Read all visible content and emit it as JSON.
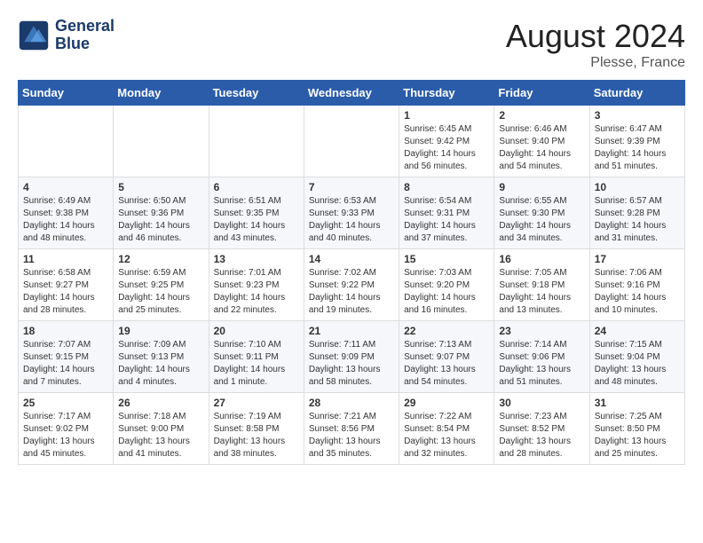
{
  "header": {
    "logo_line1": "General",
    "logo_line2": "Blue",
    "month_year": "August 2024",
    "location": "Plesse, France"
  },
  "weekdays": [
    "Sunday",
    "Monday",
    "Tuesday",
    "Wednesday",
    "Thursday",
    "Friday",
    "Saturday"
  ],
  "weeks": [
    [
      {
        "day": "",
        "info": ""
      },
      {
        "day": "",
        "info": ""
      },
      {
        "day": "",
        "info": ""
      },
      {
        "day": "",
        "info": ""
      },
      {
        "day": "1",
        "info": "Sunrise: 6:45 AM\nSunset: 9:42 PM\nDaylight: 14 hours\nand 56 minutes."
      },
      {
        "day": "2",
        "info": "Sunrise: 6:46 AM\nSunset: 9:40 PM\nDaylight: 14 hours\nand 54 minutes."
      },
      {
        "day": "3",
        "info": "Sunrise: 6:47 AM\nSunset: 9:39 PM\nDaylight: 14 hours\nand 51 minutes."
      }
    ],
    [
      {
        "day": "4",
        "info": "Sunrise: 6:49 AM\nSunset: 9:38 PM\nDaylight: 14 hours\nand 48 minutes."
      },
      {
        "day": "5",
        "info": "Sunrise: 6:50 AM\nSunset: 9:36 PM\nDaylight: 14 hours\nand 46 minutes."
      },
      {
        "day": "6",
        "info": "Sunrise: 6:51 AM\nSunset: 9:35 PM\nDaylight: 14 hours\nand 43 minutes."
      },
      {
        "day": "7",
        "info": "Sunrise: 6:53 AM\nSunset: 9:33 PM\nDaylight: 14 hours\nand 40 minutes."
      },
      {
        "day": "8",
        "info": "Sunrise: 6:54 AM\nSunset: 9:31 PM\nDaylight: 14 hours\nand 37 minutes."
      },
      {
        "day": "9",
        "info": "Sunrise: 6:55 AM\nSunset: 9:30 PM\nDaylight: 14 hours\nand 34 minutes."
      },
      {
        "day": "10",
        "info": "Sunrise: 6:57 AM\nSunset: 9:28 PM\nDaylight: 14 hours\nand 31 minutes."
      }
    ],
    [
      {
        "day": "11",
        "info": "Sunrise: 6:58 AM\nSunset: 9:27 PM\nDaylight: 14 hours\nand 28 minutes."
      },
      {
        "day": "12",
        "info": "Sunrise: 6:59 AM\nSunset: 9:25 PM\nDaylight: 14 hours\nand 25 minutes."
      },
      {
        "day": "13",
        "info": "Sunrise: 7:01 AM\nSunset: 9:23 PM\nDaylight: 14 hours\nand 22 minutes."
      },
      {
        "day": "14",
        "info": "Sunrise: 7:02 AM\nSunset: 9:22 PM\nDaylight: 14 hours\nand 19 minutes."
      },
      {
        "day": "15",
        "info": "Sunrise: 7:03 AM\nSunset: 9:20 PM\nDaylight: 14 hours\nand 16 minutes."
      },
      {
        "day": "16",
        "info": "Sunrise: 7:05 AM\nSunset: 9:18 PM\nDaylight: 14 hours\nand 13 minutes."
      },
      {
        "day": "17",
        "info": "Sunrise: 7:06 AM\nSunset: 9:16 PM\nDaylight: 14 hours\nand 10 minutes."
      }
    ],
    [
      {
        "day": "18",
        "info": "Sunrise: 7:07 AM\nSunset: 9:15 PM\nDaylight: 14 hours\nand 7 minutes."
      },
      {
        "day": "19",
        "info": "Sunrise: 7:09 AM\nSunset: 9:13 PM\nDaylight: 14 hours\nand 4 minutes."
      },
      {
        "day": "20",
        "info": "Sunrise: 7:10 AM\nSunset: 9:11 PM\nDaylight: 14 hours\nand 1 minute."
      },
      {
        "day": "21",
        "info": "Sunrise: 7:11 AM\nSunset: 9:09 PM\nDaylight: 13 hours\nand 58 minutes."
      },
      {
        "day": "22",
        "info": "Sunrise: 7:13 AM\nSunset: 9:07 PM\nDaylight: 13 hours\nand 54 minutes."
      },
      {
        "day": "23",
        "info": "Sunrise: 7:14 AM\nSunset: 9:06 PM\nDaylight: 13 hours\nand 51 minutes."
      },
      {
        "day": "24",
        "info": "Sunrise: 7:15 AM\nSunset: 9:04 PM\nDaylight: 13 hours\nand 48 minutes."
      }
    ],
    [
      {
        "day": "25",
        "info": "Sunrise: 7:17 AM\nSunset: 9:02 PM\nDaylight: 13 hours\nand 45 minutes."
      },
      {
        "day": "26",
        "info": "Sunrise: 7:18 AM\nSunset: 9:00 PM\nDaylight: 13 hours\nand 41 minutes."
      },
      {
        "day": "27",
        "info": "Sunrise: 7:19 AM\nSunset: 8:58 PM\nDaylight: 13 hours\nand 38 minutes."
      },
      {
        "day": "28",
        "info": "Sunrise: 7:21 AM\nSunset: 8:56 PM\nDaylight: 13 hours\nand 35 minutes."
      },
      {
        "day": "29",
        "info": "Sunrise: 7:22 AM\nSunset: 8:54 PM\nDaylight: 13 hours\nand 32 minutes."
      },
      {
        "day": "30",
        "info": "Sunrise: 7:23 AM\nSunset: 8:52 PM\nDaylight: 13 hours\nand 28 minutes."
      },
      {
        "day": "31",
        "info": "Sunrise: 7:25 AM\nSunset: 8:50 PM\nDaylight: 13 hours\nand 25 minutes."
      }
    ]
  ]
}
